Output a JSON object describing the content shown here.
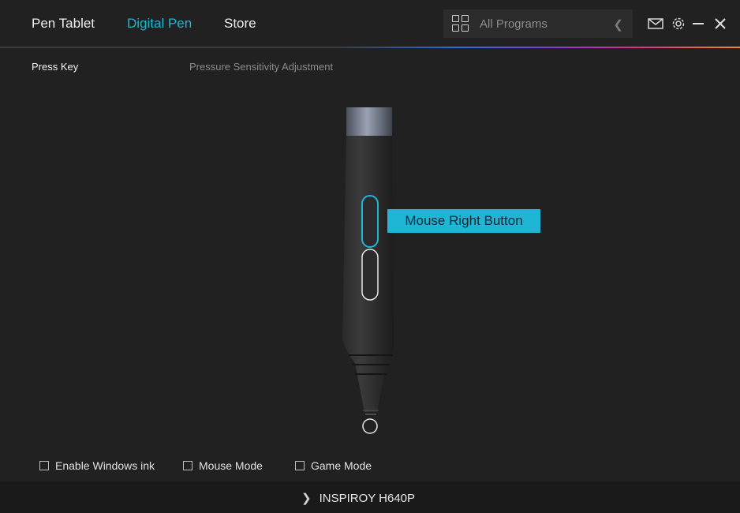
{
  "nav": {
    "tabs": [
      {
        "label": "Pen Tablet",
        "active": false
      },
      {
        "label": "Digital Pen",
        "active": true
      },
      {
        "label": "Store",
        "active": false
      }
    ]
  },
  "programs": {
    "label": "All Programs",
    "icon": "grid-icon"
  },
  "window_controls": {
    "icons": [
      "mail-icon",
      "gear-icon",
      "minimize-icon",
      "close-icon"
    ]
  },
  "subtabs": {
    "press_key": "Press Key",
    "pressure": "Pressure Sensitivity Adjustment"
  },
  "pen": {
    "selected_button": "Mouse Right Button"
  },
  "options": {
    "windows_ink": {
      "label": "Enable Windows ink",
      "checked": false
    },
    "mouse_mode": {
      "label": "Mouse Mode",
      "checked": false
    },
    "game_mode": {
      "label": "Game Mode",
      "checked": false
    }
  },
  "footer": {
    "device": "INSPIROY H640P"
  },
  "colors": {
    "accent": "#1fb6d6",
    "background": "#212121"
  }
}
